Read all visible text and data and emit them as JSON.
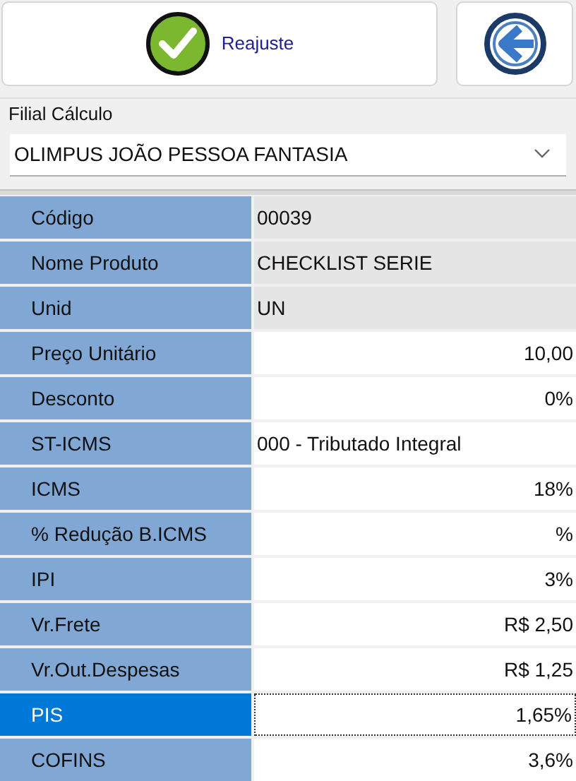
{
  "toolbar": {
    "confirm_button": {
      "label": "Reajuste"
    }
  },
  "branch": {
    "label": "Filial Cálculo",
    "value": "OLIMPUS JOÃO PESSOA FANTASIA"
  },
  "grid": {
    "rows": [
      {
        "label": "Código",
        "value": "00039",
        "kind": "readonly",
        "selected": false
      },
      {
        "label": "Nome Produto",
        "value": "CHECKLIST SERIE",
        "kind": "readonly",
        "selected": false
      },
      {
        "label": "Unid",
        "value": "UN",
        "kind": "readonly",
        "selected": false
      },
      {
        "label": "Preço Unitário",
        "value": "10,00",
        "kind": "number",
        "selected": false
      },
      {
        "label": "Desconto",
        "value": "0%",
        "kind": "number",
        "selected": false
      },
      {
        "label": "ST-ICMS",
        "value": "000 - Tributado Integral",
        "kind": "choice",
        "selected": false
      },
      {
        "label": "ICMS",
        "value": "18%",
        "kind": "number",
        "selected": false
      },
      {
        "label": "% Redução B.ICMS",
        "value": "%",
        "kind": "number",
        "selected": false
      },
      {
        "label": "IPI",
        "value": "3%",
        "kind": "number",
        "selected": false
      },
      {
        "label": "Vr.Frete",
        "value": "R$ 2,50",
        "kind": "number",
        "selected": false
      },
      {
        "label": "Vr.Out.Despesas",
        "value": "R$ 1,25",
        "kind": "number",
        "selected": false
      },
      {
        "label": "PIS",
        "value": "1,65%",
        "kind": "number",
        "selected": true
      },
      {
        "label": "COFINS",
        "value": "3,6%",
        "kind": "number",
        "selected": false
      }
    ]
  }
}
